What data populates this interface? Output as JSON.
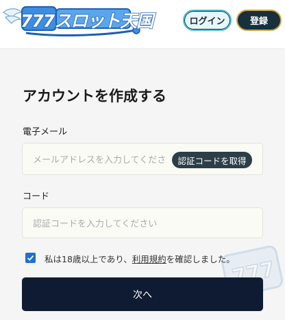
{
  "header": {
    "logo_text": "777スロット天国",
    "login_label": "ログイン",
    "register_label": "登録"
  },
  "form": {
    "title": "アカウントを作成する",
    "email_label": "電子メール",
    "email_placeholder": "メールアドレスを入力してくださ",
    "get_code_label": "認証コードを取得",
    "code_label": "コード",
    "code_placeholder": "認証コードを入力してください",
    "agree_prefix": "私は18歳以上であり、",
    "agree_link": "利用規約",
    "agree_suffix": "を確認しました。",
    "agree_checked": true,
    "next_label": "次へ"
  },
  "colors": {
    "accent": "#1f6fd1",
    "primary_button": "#0f1a33",
    "login_border": "#4fc1d6",
    "register_bg": "#17303c",
    "register_border": "#c8a84a"
  },
  "icons": {
    "logo": "wings-logo-icon",
    "check": "checkmark-icon",
    "watermark": "777-watermark-icon"
  }
}
